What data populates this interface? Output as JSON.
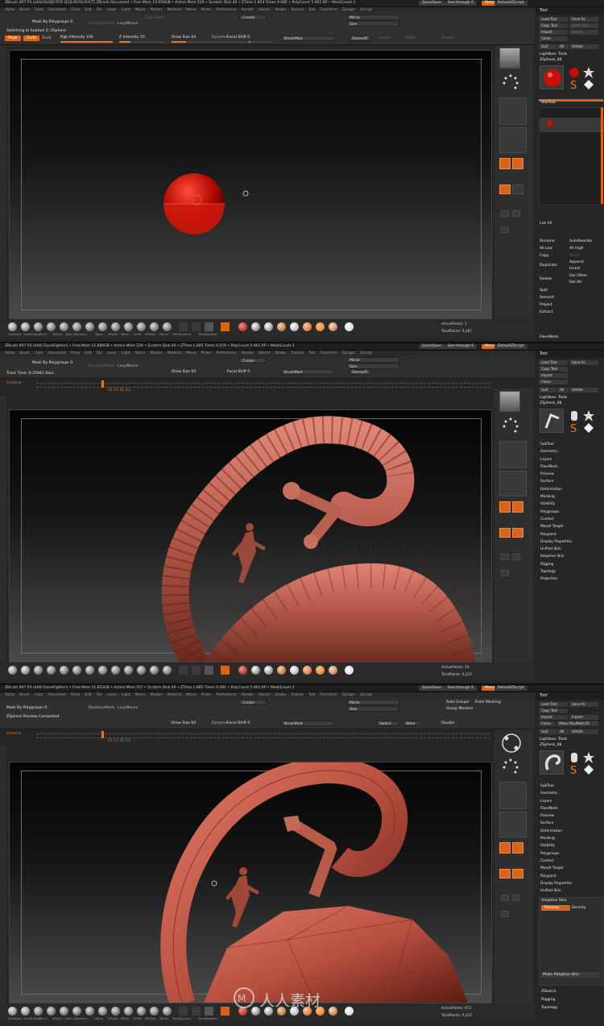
{
  "screens": [
    {
      "title": "ZBrush 4R7 P3 (x64)[SUQD-YCIF-QCJI-RESS-VHCT]   ZBrush Document   • Free Mem 10.659GB • Active Mem 529 • Scratch Disk 40 • ZTime 1.854 Timer 0.085 • PolyCount 5.961 KP • MeshCount 1",
      "quicksave": "QuickSave",
      "see_through": "See-through 0",
      "menus": "Menus",
      "defaultscript": "DefaultZScript",
      "menubar": [
        "Alpha",
        "Brush",
        "Color",
        "Document",
        "Draw",
        "Edit",
        "File",
        "Layer",
        "Light",
        "Macro",
        "Marker",
        "Material",
        "Movie",
        "Picker",
        "Preferences",
        "Render",
        "Stencil",
        "Stroke",
        "Texture",
        "Tool",
        "Transform",
        "Zplugin",
        "Zscript"
      ],
      "shelf": {
        "mask_label": "Mask By Polygroups 0",
        "switch_msg": "Switching to Subtool 2:  ZSphere",
        "mrgb": "Mrgb",
        "zadd": "Zadd",
        "zsub": "Zsub",
        "rgb_intensity": "Rgb Intensity 100",
        "z_intensity": "Z Intensity 25",
        "draw_size": "Draw Size 64",
        "dynamic": "Dynamic",
        "focal_shift": "Focal Shift 0",
        "brush_mod": "BrushMod",
        "lazymouse": "LazyMouse",
        "backface": "BackfaceMask",
        "create": "Create",
        "mirror": "Mirror",
        "size": "Size",
        "stereo": "StereoAT",
        "switch": "Switch",
        "weld": "Weld",
        "double": "Double"
      },
      "tool": {
        "title": "Tool",
        "load": "Load Tool",
        "save": "Save As",
        "copy": "Copy Tool",
        "paste": "Paste Tool",
        "import": "Import",
        "export": "Export",
        "clone": "Clone",
        "goz": "GoZ",
        "all": "All",
        "visible": "Visible",
        "lightbox": "Lightbox› Tools",
        "current": "ZSphere_48",
        "subtool": "SubTool",
        "list_all": "List All",
        "items": [
          "Rename",
          "AutoReorder",
          "All Low",
          "All High",
          "Copy",
          "Paste",
          "Append",
          "Duplicate",
          "Insert",
          "Delete",
          "Del Other",
          "Del All",
          "Split",
          "Remesh",
          "Project",
          "Extract"
        ],
        "fibermesh": "FiberMesh"
      },
      "bottom_materials": [
        "Standard",
        "ClayBuildup",
        "Pinch",
        "hPolish",
        "Dam_Standard",
        "Move",
        "hPolish",
        "Move",
        "Inflat",
        "MPolish",
        "Planar",
        "TrimDynamic",
        "TrimAdaptive"
      ],
      "active_points": "ActivePoints: 1",
      "total_points": "TotalPoints: 9,287"
    },
    {
      "title": "ZBrush 4R7 P3 (x64)   DuneFighter1   • Free Mem 11.896GB • Active Mem 529 • Scratch Disk 40 • ZTime 1.895 Timer 0.076 • PolyCount 5.961 KP • MeshCount 2",
      "track_time": "Track Time: 6.25941 Secs",
      "camera": "Camera",
      "frame_numbers": "01:11  01:13",
      "tool_menu": [
        "SubTool",
        "Geometry",
        "Layers",
        "FiberMesh",
        "Preview",
        "Surface",
        "Deformation",
        "Masking",
        "Visibility",
        "Polygroups",
        "Contact",
        "Morph Target",
        "Polypaint",
        "Display Properties",
        "Unified Skin",
        "Adaptive Skin",
        "Rigging",
        "Topology",
        "Projection"
      ],
      "active_points": "ActivePoints: 19",
      "total_points": "TotalPoints: 6,225"
    },
    {
      "title": "ZBrush 4R7 P3 (x64)   DuneFighter1   • Free Mem 11.852GB • Active Mem 557 • Scratch Disk 40 • ZTime 1.885 Timer 0.081 • PolyCount 5.961 KP • MeshCount 2",
      "preview_msg": "ZSphere Preview Completed.",
      "mask_label": "Mask By Polygroups 0",
      "backface": "BackfaceMask",
      "lazymouse": "LazyMouse",
      "clone_poly": "Make PolyMesh3D",
      "adaptive_skin": "Adaptive Skin",
      "preview": "Preview",
      "density": "Density",
      "make_adaptive": "Make Adaptive Skin",
      "zsketch": "ZSketch",
      "rigging": "Rigging",
      "topology": "Topology",
      "tool_menu": [
        "SubTool",
        "Geometry",
        "Layers",
        "FiberMesh",
        "Preview",
        "Surface",
        "Deformation",
        "Masking",
        "Visibility",
        "Polygroups",
        "Contact",
        "Morph Target",
        "Polypaint",
        "Display Properties",
        "Unified Skin"
      ],
      "active_points": "ActivePoints: 972",
      "total_points": "TotalPoints: 6,225",
      "group_masked": "Group Masked",
      "auto_groups": "Auto Groups",
      "from_masking": "From Masking"
    }
  ],
  "watermark": "人人素材"
}
